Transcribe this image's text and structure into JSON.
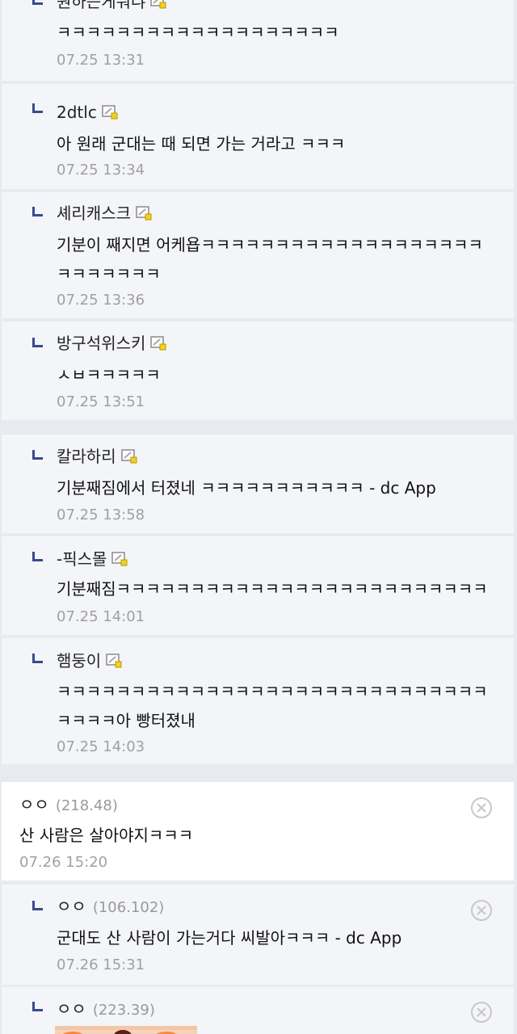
{
  "comments": [
    {
      "nick": "원하는게뭐냐",
      "text": "ㅋㅋㅋㅋㅋㅋㅋㅋㅋㅋㅋㅋㅋㅋㅋㅋㅋㅋㅋ",
      "date": "07.25 13:31"
    },
    {
      "nick": "2dtlc",
      "text": "아 원래 군대는 때 되면 가는 거라고 ㅋㅋㅋ",
      "date": "07.25 13:34"
    },
    {
      "nick": "셰리캐스크",
      "text": "기분이 째지면 어케욥ㅋㅋㅋㅋㅋㅋㅋㅋㅋㅋㅋㅋㅋㅋㅋㅋㅋㅋㅋㅋㅋㅋㅋㅋㅋㅋ",
      "date": "07.25 13:36"
    },
    {
      "nick": "방구석위스키",
      "text": "ㅅㅂㅋㅋㅋㅋㅋ",
      "date": "07.25 13:51"
    },
    {
      "nick": "칼라하리",
      "text": "기분째짐에서 터졌네 ㅋㅋㅋㅋㅋㅋㅋㅋㅋㅋㅋ - dc App",
      "date": "07.25 13:58"
    },
    {
      "nick": "-픽스몰",
      "text": "기분째짐ㅋㅋㅋㅋㅋㅋㅋㅋㅋㅋㅋㅋㅋㅋㅋㅋㅋㅋㅋㅋㅋㅋㅋㅋㅋ",
      "date": "07.25 14:01"
    },
    {
      "nick": "햄둥이",
      "text": "ㅋㅋㅋㅋㅋㅋㅋㅋㅋㅋㅋㅋㅋㅋㅋㅋㅋㅋㅋㅋㅋㅋㅋㅋㅋㅋㅋㅋㅋㅋㅋㅋㅋ아 빵터졌내",
      "date": "07.25 14:03"
    },
    {
      "nick": "ㅇㅇ",
      "ip": "(218.48)",
      "text": "산 사람은 살아야지ㅋㅋㅋ",
      "date": "07.26 15:20"
    },
    {
      "nick": "ㅇㅇ",
      "ip": "(106.102)",
      "text": "군대도 산 사람이 가는거다 씨발아ㅋㅋㅋ - dc App",
      "date": "07.26 15:31"
    },
    {
      "nick": "ㅇㅇ",
      "ip": "(223.39)"
    }
  ],
  "colors": {
    "reply_bg": "#f4f5f9",
    "comment_bg": "#ffffff",
    "separator": "#e8eaf0",
    "arrow": "#3b4a8c",
    "date": "#a0a0a0",
    "ip": "#999999"
  },
  "icons": {
    "reply_arrow": "reply-arrow-icon",
    "gallery_member": "gallog-icon",
    "delete": "delete-icon"
  }
}
